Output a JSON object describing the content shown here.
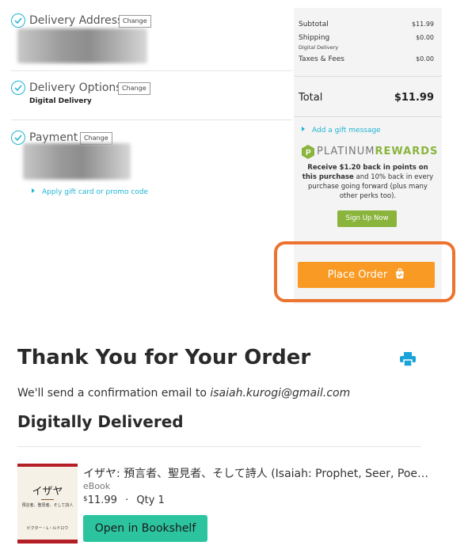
{
  "steps": {
    "address": {
      "title": "Delivery Address",
      "change": "Change"
    },
    "options": {
      "title": "Delivery Options",
      "change": "Change",
      "value": "Digital Delivery"
    },
    "payment": {
      "title": "Payment",
      "change": "Change"
    },
    "gift_card_link": "Apply gift card or promo code"
  },
  "summary": {
    "subtotal_label": "Subtotal",
    "subtotal_value": "$11.99",
    "shipping_label": "Shipping",
    "shipping_note": "Digital Delivery",
    "shipping_value": "$0.00",
    "taxes_label": "Taxes & Fees",
    "taxes_value": "$0.00",
    "total_label": "Total",
    "total_value": "$11.99",
    "gift_message_link": "Add a gift message",
    "rewards_brand_1": "PLATINUM",
    "rewards_brand_2": "REWARDS",
    "rewards_bold": "Receive $1.20 back in points on this purchase",
    "rewards_rest": " and 10% back in every purchase going forward (plus many other perks too).",
    "signup_label": "Sign Up Now",
    "place_order_label": "Place Order"
  },
  "confirmation": {
    "heading": "Thank You for Your Order",
    "email_text": "We'll send a confirmation email to ",
    "email": "isaiah.kurogi@gmail.com",
    "section_heading": "Digitally Delivered"
  },
  "product": {
    "title": "イザヤ: 預言者、聖見者、そして詩人 (Isaiah: Prophet, Seer, Poe…",
    "format": "eBook",
    "price": "11.99",
    "currency": "$",
    "separator": "·",
    "qty": "Qty 1",
    "open_label": "Open in Bookshelf",
    "cover_title": "イザヤ",
    "cover_subtitle": "預言者、聖見者、そして詩人",
    "cover_author": "ビクター・L・ルドロウ"
  },
  "colors": {
    "accent": "#1fb5d4",
    "place_order": "#f99a24",
    "highlight_border": "#ec7330",
    "rewards_green": "#8ab43c",
    "open_button": "#2cc49f"
  },
  "icons": [
    "check-circle-icon",
    "triangle-right-icon",
    "platinum-rewards-logo",
    "shopping-bag-check-icon",
    "print-icon"
  ]
}
